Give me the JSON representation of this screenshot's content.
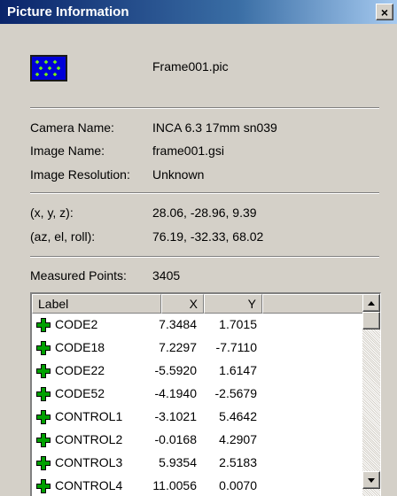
{
  "window": {
    "title": "Picture Information",
    "close_label": "×"
  },
  "file": {
    "icon": "picture-grid-icon",
    "name": "Frame001.pic"
  },
  "camera": {
    "camera_name_label": "Camera Name:",
    "camera_name_value": "INCA 6.3 17mm sn039",
    "image_name_label": "Image Name:",
    "image_name_value": "frame001.gsi",
    "resolution_label": "Image Resolution:",
    "resolution_value": "Unknown"
  },
  "position": {
    "xyz_label": "(x, y, z):",
    "xyz_value": "28.06, -28.96, 9.39",
    "angles_label": "(az, el, roll):",
    "angles_value": "76.19, -32.33, 68.02"
  },
  "measured": {
    "label": "Measured Points:",
    "value": "3405"
  },
  "table": {
    "columns": {
      "label": "Label",
      "x": "X",
      "y": "Y"
    },
    "rows": [
      {
        "label": "CODE2",
        "x": "7.3484",
        "y": "1.7015"
      },
      {
        "label": "CODE18",
        "x": "7.2297",
        "y": "-7.7110"
      },
      {
        "label": "CODE22",
        "x": "-5.5920",
        "y": "1.6147"
      },
      {
        "label": "CODE52",
        "x": "-4.1940",
        "y": "-2.5679"
      },
      {
        "label": "CONTROL1",
        "x": "-3.1021",
        "y": "5.4642"
      },
      {
        "label": "CONTROL2",
        "x": "-0.0168",
        "y": "4.2907"
      },
      {
        "label": "CONTROL3",
        "x": "5.9354",
        "y": "2.5183"
      },
      {
        "label": "CONTROL4",
        "x": "11.0056",
        "y": "0.0070"
      }
    ]
  },
  "colors": {
    "title_start": "#0a246a",
    "title_end": "#a6caf0",
    "point_icon": "#008000",
    "file_icon_bg": "#0000d8"
  }
}
